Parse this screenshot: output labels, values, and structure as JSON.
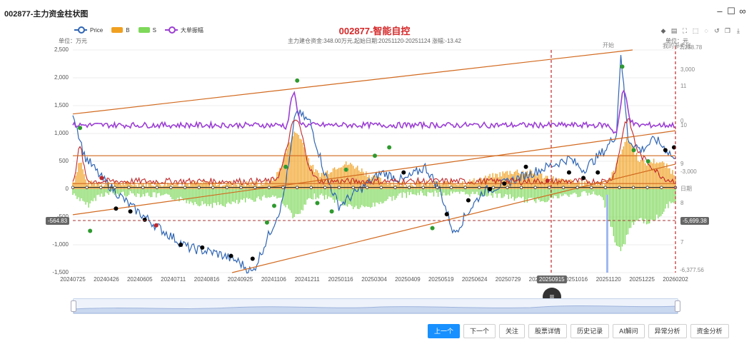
{
  "window": {
    "title": "002877-主力资金柱状图",
    "minimize": "–",
    "maximize": "☐",
    "close": "∞"
  },
  "legend": [
    {
      "name": "Price",
      "color": "#2f65b4",
      "kind": "line"
    },
    {
      "name": "B",
      "color": "#f0a020",
      "kind": "rect"
    },
    {
      "name": "S",
      "color": "#7ed85a",
      "kind": "rect"
    },
    {
      "name": "大单振幅",
      "color": "#9b3fd4",
      "kind": "line"
    }
  ],
  "header": {
    "title": "002877-智能自控",
    "subtitle": "主力建仓资金:348.00万元,起始日期:20251120-20251124 涨幅:-13.42",
    "unit_left": "单位：万元",
    "unit_right": "单位：元"
  },
  "toolbox": [
    "cube-icon",
    "doc-icon",
    "fullscreen-icon",
    "select-icon",
    "lasso-icon",
    "restore-icon",
    "copy-icon",
    "save-icon"
  ],
  "chart_data": {
    "type": "bar",
    "y_axis": {
      "ticks": [
        "2,500",
        "2,000",
        "1,500",
        "1,000",
        "500",
        "0",
        "-500",
        "-1,000",
        "-1,500"
      ],
      "min": -1500,
      "max": 2500
    },
    "x_axis": {
      "ticks": [
        "20240725",
        "20240426",
        "20240605",
        "20240711",
        "20240816",
        "20240925",
        "20241106",
        "20241211",
        "20250116",
        "20250304",
        "20250409",
        "20250519",
        "20250624",
        "20250729",
        "20250915",
        "20251016",
        "20251120",
        "20251225",
        "20260202"
      ]
    },
    "right_axis_labels": [
      "3,000",
      "11",
      "0",
      "10",
      "9",
      "-3,000",
      "日期",
      "8",
      "7"
    ],
    "right_top_labels": [
      "我的参考线",
      "2,258.78"
    ],
    "right_bottom_label": "-6,377.56",
    "annotation": "开始",
    "crosshair": {
      "x_label": "20250915",
      "y_left": "-564.83",
      "y_right": "-5,699.38"
    },
    "series": [
      {
        "name": "B"
      },
      {
        "name": "S"
      },
      {
        "name": "Price"
      },
      {
        "name": "大单振幅"
      }
    ]
  },
  "buttons": [
    "上一个",
    "下一个",
    "关注",
    "股票详情",
    "历史记录",
    "AI解问",
    "异常分析",
    "资金分析"
  ],
  "menu_icon": "≡"
}
